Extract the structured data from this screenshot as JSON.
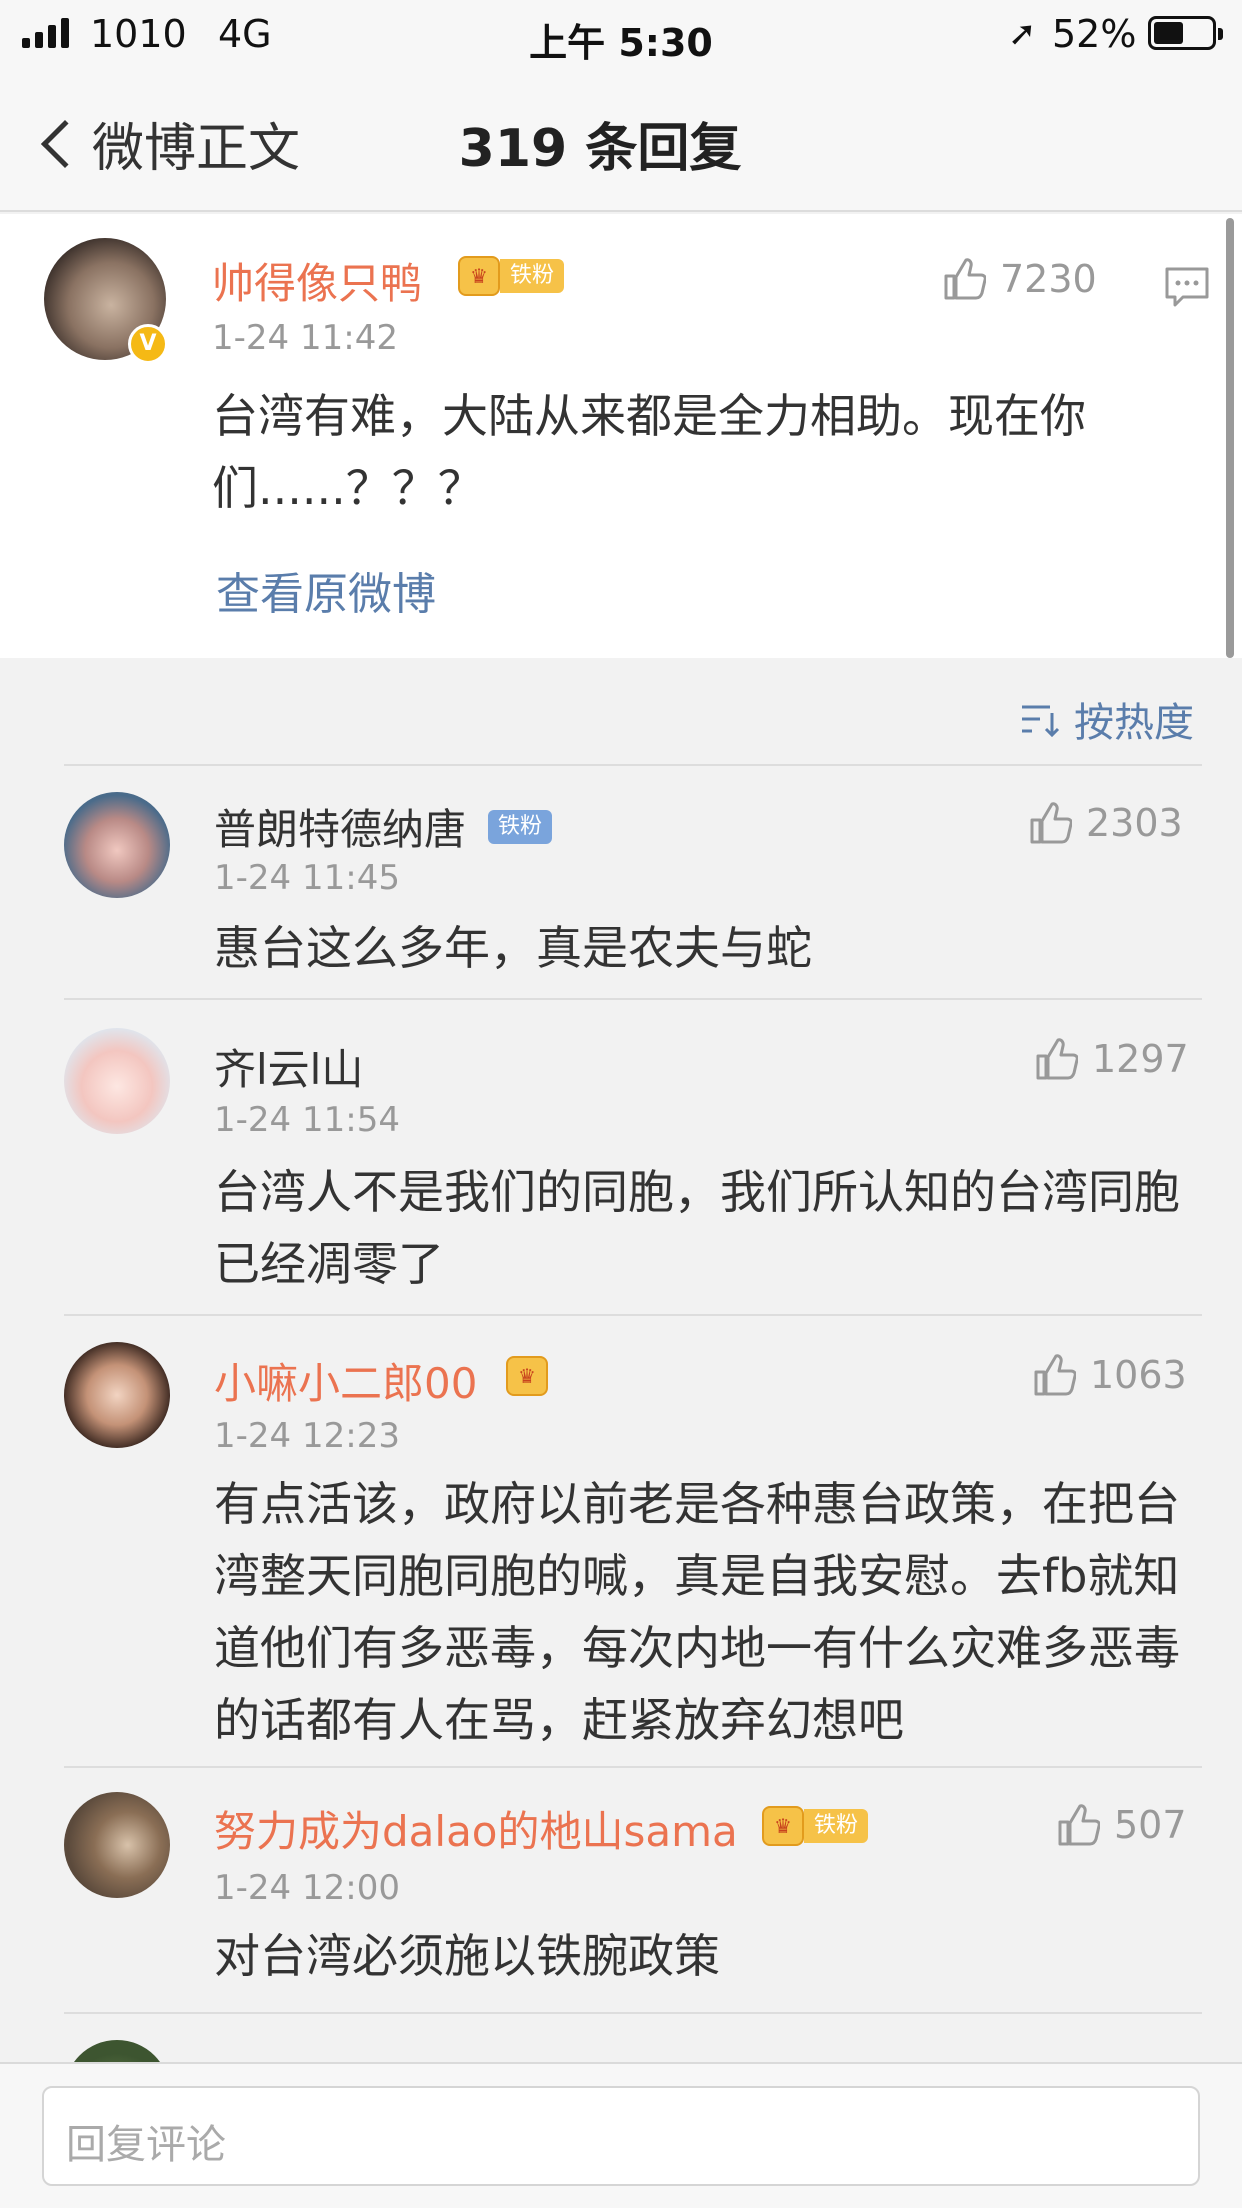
{
  "status_bar": {
    "carrier": "1010",
    "network": "4G",
    "time": "上午 5:30",
    "battery_pct": "52%",
    "battery_level": 0.52
  },
  "nav": {
    "back_label": "微博正文",
    "title": "319 条回复"
  },
  "main_comment": {
    "username": "帅得像只鸭",
    "badge_label": "铁粉",
    "verified_icon": "V",
    "time": "1-24 11:42",
    "likes": "7230",
    "text": "台湾有难，大陆从来都是全力相助。现在你们......？？？",
    "view_origin_label": "查看原微博"
  },
  "sort_label": "按热度",
  "replies": [
    {
      "username": "普朗特德纳唐",
      "badge_label": "铁粉",
      "time": "1-24 11:45",
      "likes": "2303",
      "text": "惠台这么多年，真是农夫与蛇"
    },
    {
      "username": "齐l云l山",
      "time": "1-24 11:54",
      "likes": "1297",
      "text": "台湾人不是我们的同胞，我们所认知的台湾同胞已经凋零了"
    },
    {
      "username": "小嘛小二郎00",
      "time": "1-24 12:23",
      "likes": "1063",
      "text": "有点活该，政府以前老是各种惠台政策，在把台湾整天同胞同胞的喊，真是自我安慰。去fb就知道他们有多恶毒，每次内地一有什么灾难多恶毒的话都有人在骂，赶紧放弃幻想吧"
    },
    {
      "username": "努力成为dalao的杝山sama",
      "badge_label": "铁粉",
      "time": "1-24 12:00",
      "likes": "507",
      "text": "对台湾必须施以铁腕政策"
    }
  ],
  "reply_input": {
    "placeholder": "回复评论"
  },
  "colors": {
    "accent_orange": "#eb7350",
    "link_blue": "#5a7dab"
  }
}
